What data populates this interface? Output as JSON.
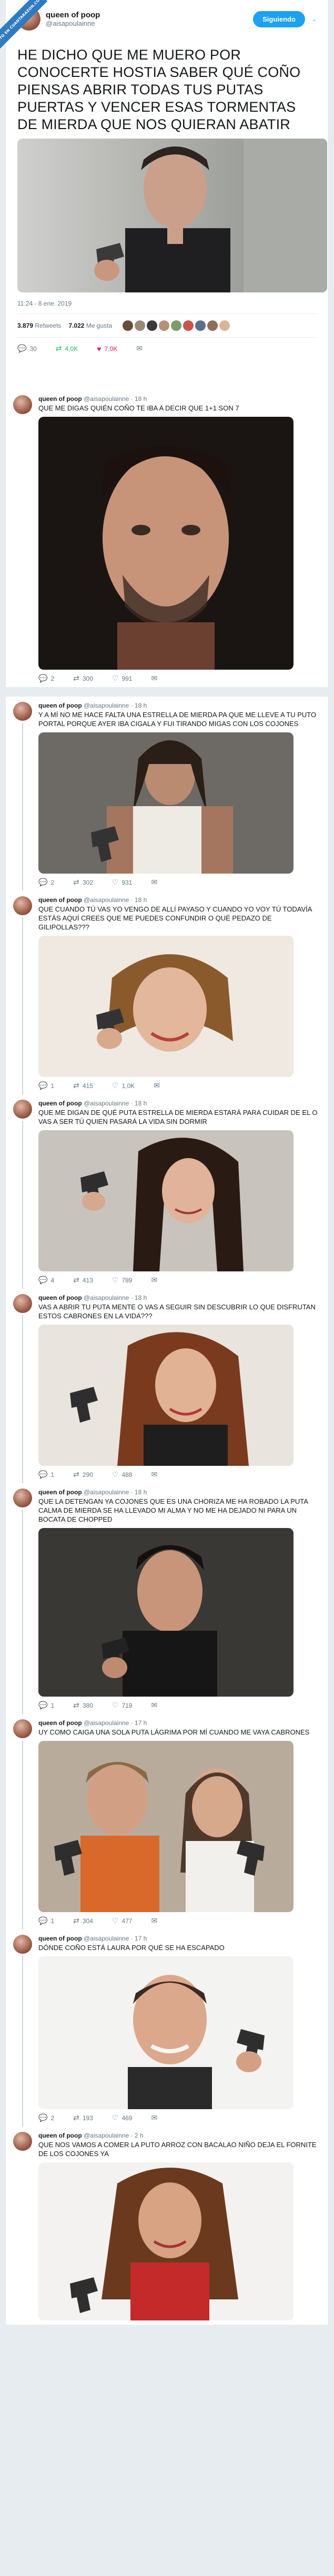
{
  "ribbon": "VISTO EN CUANTARAZON.COM",
  "main": {
    "name": "queen of poop",
    "handle": "@aisapoulainne",
    "follow_label": "Siguiendo",
    "caret": "⌄",
    "text": "HE DICHO QUE ME MUERO POR CONOCERTE HOSTIA SABER QUÉ COÑO PIENSAS ABRIR TODAS TUS PUTAS PUERTAS Y VENCER ESAS TORMENTAS DE MIERDA QUE NOS QUIERAN ABATIR",
    "time": "11:24 - 8 ene. 2019",
    "retweets": "3.879",
    "retweets_label": "Retweets",
    "likes": "7.022",
    "likes_label": "Me gusta",
    "actions": {
      "reply": "30",
      "retweet": "4,0K",
      "like": "7,0K"
    }
  },
  "replies": [
    {
      "name": "queen of poop",
      "handle": "@aisapoulainne · 18 h",
      "text": "QUE ME DIGAS QUIÉN COÑO TE IBA A DECIR QUE 1+1 SON 7",
      "reply": "2",
      "retweet": "300",
      "like": "991"
    },
    {
      "name": "queen of poop",
      "handle": "@aisapoulainne · 18 h",
      "text": "Y A MÍ NO ME HACE FALTA UNA ESTRELLA DE MIERDA PA QUE ME LLEVE A TU PUTO PORTAL PORQUE AYER IBA CIGALA Y FUI TIRANDO MIGAS CON LOS COJONES",
      "reply": "2",
      "retweet": "302",
      "like": "931"
    },
    {
      "name": "queen of poop",
      "handle": "@aisapoulainne · 18 h",
      "text": "QUE CUANDO TÚ VAS YO VENGO DE ALLÍ PAYASO Y CUANDO YO VOY TÚ TODAVÍA ESTÁS AQUÍ CREES QUE ME PUEDES CONFUNDIR O QUÉ PEDAZO DE GILIPOLLAS???",
      "reply": "1",
      "retweet": "415",
      "like": "1,0K"
    },
    {
      "name": "queen of poop",
      "handle": "@aisapoulainne · 18 h",
      "text": "QUE ME DIGAN DE QUÉ PUTA ESTRELLA DE MIERDA ESTARÁ PARA CUIDAR DE EL O VAS A SER TÚ QUIEN PASARÁ LA VIDA SIN DORMIR",
      "reply": "4",
      "retweet": "413",
      "like": "789"
    },
    {
      "name": "queen of poop",
      "handle": "@aisapoulainne · 18 h",
      "text": "VAS A ABRIR TU PUTA MENTE O VAS A SEGUIR SIN DESCUBRIR LO QUE DISFRUTAN ESTOS CABRONES EN LA VIDA???",
      "reply": "1",
      "retweet": "290",
      "like": "488"
    },
    {
      "name": "queen of poop",
      "handle": "@aisapoulainne · 18 h",
      "text": "QUE LA DETENGAN YA COJONES QUE ES UNA CHORIZA ME HA ROBADO LA PUTA CALMA DE MIERDA SE HA LLEVADO MI ALMA Y NO ME HA DEJADO NI PARA UN BOCATA DE CHOPPED",
      "reply": "1",
      "retweet": "380",
      "like": "719"
    },
    {
      "name": "queen of poop",
      "handle": "@aisapoulainne · 17 h",
      "text": "UY COMO CAIGA UNA SOLA PUTA LÁGRIMA POR MÍ CUANDO ME VAYA CABRONES",
      "reply": "1",
      "retweet": "304",
      "like": "477"
    },
    {
      "name": "queen of poop",
      "handle": "@aisapoulainne · 17 h",
      "text": "DÓNDE COÑO ESTÁ LAURA POR QUÉ SE HA ESCAPADO",
      "reply": "2",
      "retweet": "193",
      "like": "469"
    },
    {
      "name": "queen of poop",
      "handle": "@aisapoulainne · 2 h",
      "text": "QUE NOS VAMOS A COMER LA PUTO ARROZ CON BACALAO NIÑO DEJA EL FORNITE DE LOS COJONES YA",
      "reply": "",
      "retweet": "",
      "like": ""
    }
  ]
}
